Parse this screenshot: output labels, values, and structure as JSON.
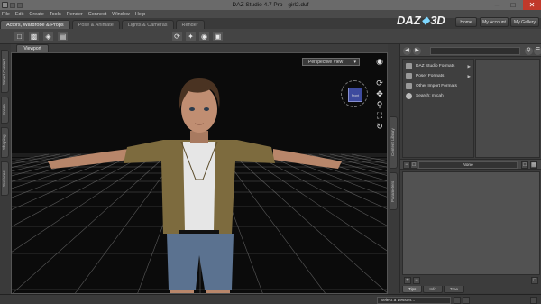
{
  "window": {
    "title": "DAZ Studio 4.7 Pro - girl2.duf",
    "minimize": "–",
    "maximize": "□",
    "close": "✕"
  },
  "menu": [
    "File",
    "Edit",
    "Create",
    "Tools",
    "Render",
    "Connect",
    "Window",
    "Help"
  ],
  "brand": {
    "text_left": "DAZ",
    "text_right": "3D"
  },
  "top_buttons": {
    "home": "Home",
    "account": "My Account",
    "gallery": "My Gallery"
  },
  "tabs": [
    {
      "label": "Actors, Wardrobe & Props",
      "active": true
    },
    {
      "label": "Pose & Animate",
      "active": false
    },
    {
      "label": "Lights & Cameras",
      "active": false
    },
    {
      "label": "Render",
      "active": false
    }
  ],
  "left_side_tabs": [
    "Smart Content",
    "Scene",
    "Shaping",
    "Surfaces"
  ],
  "right_side_tabs": [
    "Content Library",
    "Parameters"
  ],
  "viewport": {
    "tab_label": "Viewport",
    "camera": "Perspective View",
    "cube_face": "Front"
  },
  "content_library": {
    "tree": [
      {
        "label": "DAZ Studio Formats",
        "expandable": true
      },
      {
        "label": "Poser Formats",
        "expandable": true
      },
      {
        "label": "Other Import Formats",
        "expandable": false
      },
      {
        "label": "Search: micah",
        "expandable": false
      }
    ],
    "filter_value": "None",
    "tabs": [
      {
        "label": "Tips",
        "active": true
      },
      {
        "label": "Info",
        "active": false
      },
      {
        "label": "Tree",
        "active": false
      }
    ]
  },
  "status": {
    "lesson_placeholder": "Select a Lesson..."
  },
  "colors": {
    "viewport_bg": "#0b0b0b",
    "grid": "#9a9a9a",
    "nav_cube": "#3d4a9e",
    "panel_bg": "#3c3c3c"
  }
}
